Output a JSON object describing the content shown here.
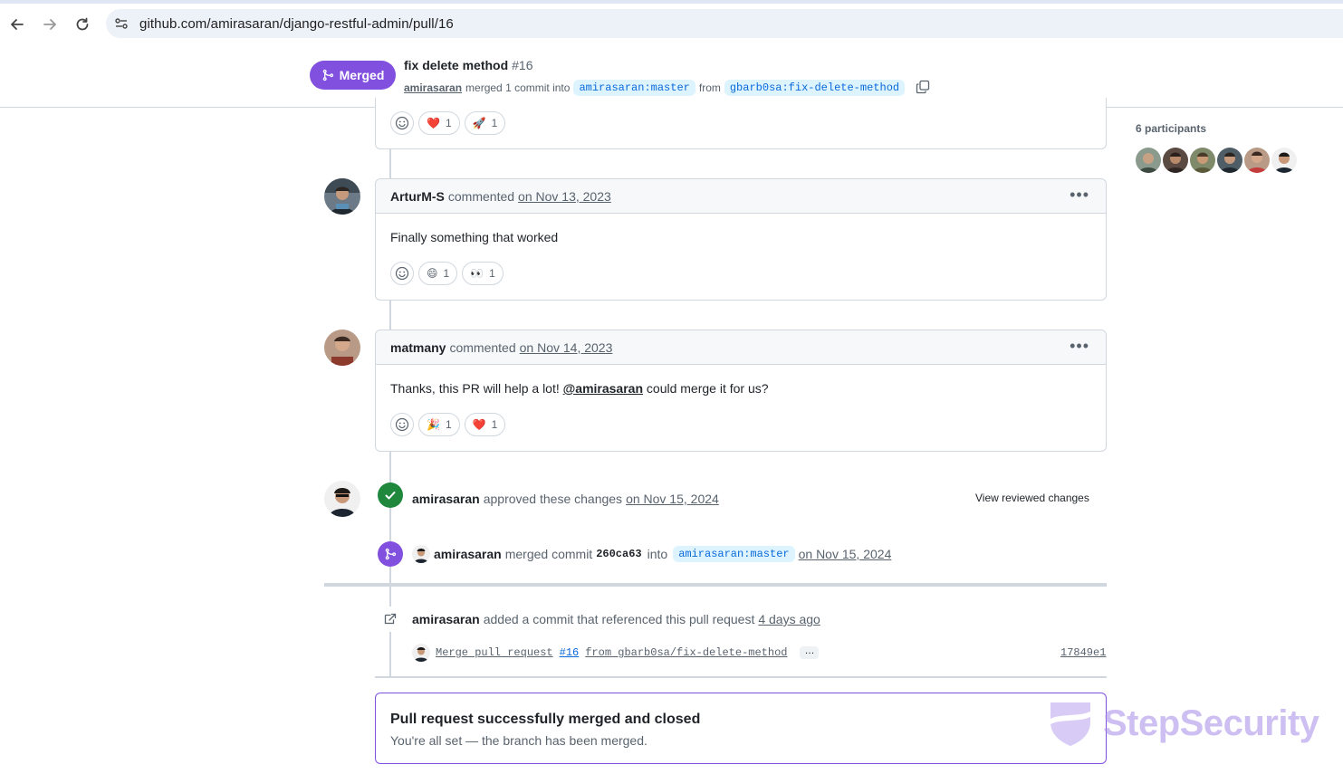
{
  "browser": {
    "url": "github.com/amirasaran/django-restful-admin/pull/16"
  },
  "pr_header": {
    "status": "Merged",
    "title": "fix delete method",
    "number": "#16",
    "author": "amirasaran",
    "merge_text": "merged 1 commit into",
    "base_branch": "amirasaran:master",
    "from_text": "from",
    "head_branch": "gbarb0sa:fix-delete-method"
  },
  "top_comment": {
    "reactions": [
      {
        "emoji": "❤️",
        "count": "1"
      },
      {
        "emoji": "🚀",
        "count": "1"
      }
    ]
  },
  "comments": [
    {
      "user": "ArturM-S",
      "action": "commented",
      "date": "on Nov 13, 2023",
      "body": "Finally something that worked",
      "reactions": [
        {
          "emoji": "😄",
          "count": "1"
        },
        {
          "emoji": "👀",
          "count": "1"
        }
      ]
    },
    {
      "user": "matmany",
      "action": "commented",
      "date": "on Nov 14, 2023",
      "body_before": "Thanks, this PR will help a lot! ",
      "mention": "@amirasaran",
      "body_after": " could merge it for us?",
      "reactions": [
        {
          "emoji": "🎉",
          "count": "1"
        },
        {
          "emoji": "❤️",
          "count": "1"
        }
      ]
    }
  ],
  "approval": {
    "user": "amirasaran",
    "text": "approved these changes",
    "date": "on Nov 15, 2024",
    "view_link": "View reviewed changes"
  },
  "merge_event": {
    "user": "amirasaran",
    "text": "merged commit",
    "commit": "260ca63",
    "into": "into",
    "branch": "amirasaran:master",
    "date": "on Nov 15, 2024"
  },
  "reference_event": {
    "user": "amirasaran",
    "text": "added a commit that referenced this pull request",
    "date": "4 days ago",
    "commit_msg_before": "Merge pull request",
    "commit_issue": "#16",
    "commit_msg_after": "from gbarb0sa/fix-delete-method",
    "ellipsis": "…",
    "sha": "17849e1"
  },
  "merged_box": {
    "title": "Pull request successfully merged and closed",
    "subtitle": "You're all set — the branch has been merged."
  },
  "sidebar": {
    "participants_label": "6 participants"
  },
  "watermark": {
    "text": "StepSecurity"
  },
  "colors": {
    "merged_purple": "#8250df",
    "approved_green": "#1f883d",
    "link_blue": "#0969da"
  }
}
